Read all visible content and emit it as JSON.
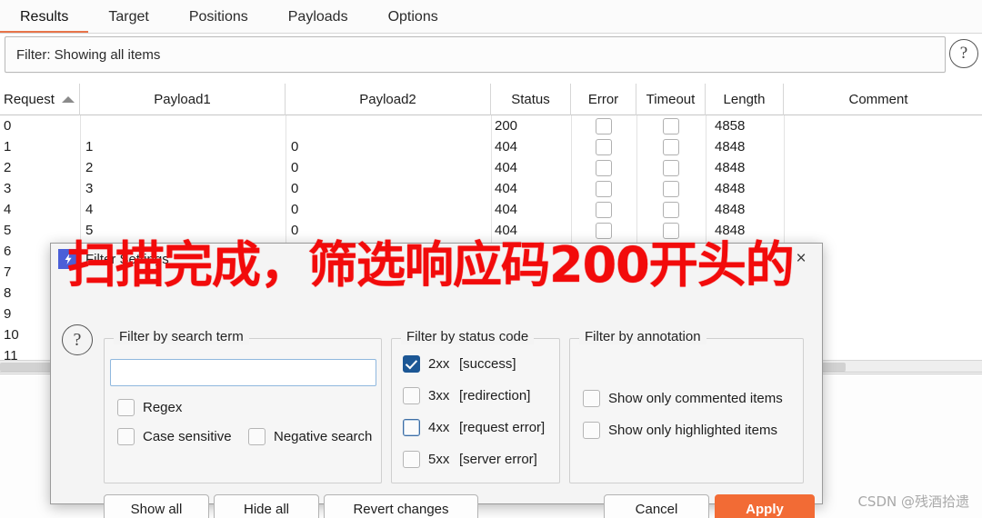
{
  "tabs": [
    {
      "label": "Results",
      "active": true
    },
    {
      "label": "Target",
      "active": false
    },
    {
      "label": "Positions",
      "active": false
    },
    {
      "label": "Payloads",
      "active": false
    },
    {
      "label": "Options",
      "active": false
    }
  ],
  "filter_bar": {
    "text": "Filter: Showing all items",
    "help_glyph": "?"
  },
  "table": {
    "columns": [
      {
        "key": "request",
        "label": "Request"
      },
      {
        "key": "payload1",
        "label": "Payload1"
      },
      {
        "key": "payload2",
        "label": "Payload2"
      },
      {
        "key": "status",
        "label": "Status"
      },
      {
        "key": "error",
        "label": "Error"
      },
      {
        "key": "timeout",
        "label": "Timeout"
      },
      {
        "key": "length",
        "label": "Length"
      },
      {
        "key": "comment",
        "label": "Comment"
      }
    ],
    "sort_column": "Request",
    "sort_direction": "ascending",
    "rows": [
      {
        "request": "0",
        "payload1": "",
        "payload2": "",
        "status": "200",
        "length": "4858",
        "comment": ""
      },
      {
        "request": "1",
        "payload1": "1",
        "payload2": "0",
        "status": "404",
        "length": "4848",
        "comment": ""
      },
      {
        "request": "2",
        "payload1": "2",
        "payload2": "0",
        "status": "404",
        "length": "4848",
        "comment": ""
      },
      {
        "request": "3",
        "payload1": "3",
        "payload2": "0",
        "status": "404",
        "length": "4848",
        "comment": ""
      },
      {
        "request": "4",
        "payload1": "4",
        "payload2": "0",
        "status": "404",
        "length": "4848",
        "comment": ""
      },
      {
        "request": "5",
        "payload1": "5",
        "payload2": "0",
        "status": "404",
        "length": "4848",
        "comment": ""
      },
      {
        "request": "6",
        "payload1": "",
        "payload2": "",
        "status": "",
        "length": "",
        "comment": ""
      },
      {
        "request": "7",
        "payload1": "",
        "payload2": "",
        "status": "",
        "length": "",
        "comment": ""
      },
      {
        "request": "8",
        "payload1": "",
        "payload2": "",
        "status": "",
        "length": "",
        "comment": ""
      },
      {
        "request": "9",
        "payload1": "",
        "payload2": "",
        "status": "",
        "length": "",
        "comment": ""
      },
      {
        "request": "10",
        "payload1": "",
        "payload2": "",
        "status": "",
        "length": "",
        "comment": ""
      },
      {
        "request": "11",
        "payload1": "",
        "payload2": "",
        "status": "",
        "length": "",
        "comment": ""
      }
    ]
  },
  "dialog": {
    "title": "Filter Settings",
    "icon_glyph": "⚡",
    "close_glyph": "×",
    "help_glyph": "?",
    "search_group": {
      "title": "Filter by search term",
      "input_value": "",
      "input_placeholder": "",
      "checkboxes": [
        {
          "label": "Regex",
          "checked": false
        },
        {
          "label": "Case sensitive",
          "checked": false
        },
        {
          "label": "Negative search",
          "checked": false
        }
      ]
    },
    "status_group": {
      "title": "Filter by status code",
      "items": [
        {
          "code": "2xx",
          "desc": "[success]",
          "checked": true,
          "focused": false
        },
        {
          "code": "3xx",
          "desc": "[redirection]",
          "checked": false,
          "focused": false
        },
        {
          "code": "4xx",
          "desc": "[request error]",
          "checked": false,
          "focused": true
        },
        {
          "code": "5xx",
          "desc": "[server error]",
          "checked": false,
          "focused": false
        }
      ]
    },
    "annotation_group": {
      "title": "Filter by annotation",
      "checkboxes": [
        {
          "label": "Show only commented items",
          "checked": false
        },
        {
          "label": "Show only highlighted items",
          "checked": false
        }
      ]
    },
    "buttons": {
      "show_all": "Show all",
      "hide_all": "Hide all",
      "revert": "Revert changes",
      "cancel": "Cancel",
      "apply": "Apply"
    }
  },
  "annotation": {
    "red_note": "扫描完成，筛选响应码200开头的"
  },
  "watermark": "CSDN @残酒拾遗",
  "colors": {
    "accent_orange": "#f26b35",
    "tab_underline": "#e8744a",
    "checkbox_checked": "#1c5795",
    "red_note": "#f20b0b"
  }
}
